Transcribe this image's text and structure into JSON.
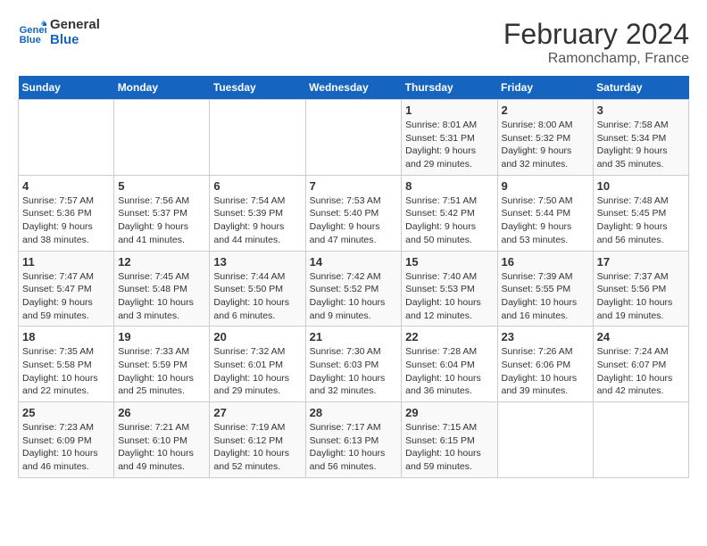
{
  "header": {
    "logo_line1": "General",
    "logo_line2": "Blue",
    "title": "February 2024",
    "subtitle": "Ramonchamp, France"
  },
  "days_of_week": [
    "Sunday",
    "Monday",
    "Tuesday",
    "Wednesday",
    "Thursday",
    "Friday",
    "Saturday"
  ],
  "weeks": [
    {
      "days": [
        {
          "number": "",
          "empty": true
        },
        {
          "number": "",
          "empty": true
        },
        {
          "number": "",
          "empty": true
        },
        {
          "number": "",
          "empty": true
        },
        {
          "number": "1",
          "sunrise": "8:01 AM",
          "sunset": "5:31 PM",
          "daylight": "9 hours and 29 minutes."
        },
        {
          "number": "2",
          "sunrise": "8:00 AM",
          "sunset": "5:32 PM",
          "daylight": "9 hours and 32 minutes."
        },
        {
          "number": "3",
          "sunrise": "7:58 AM",
          "sunset": "5:34 PM",
          "daylight": "9 hours and 35 minutes."
        }
      ]
    },
    {
      "days": [
        {
          "number": "4",
          "sunrise": "7:57 AM",
          "sunset": "5:36 PM",
          "daylight": "9 hours and 38 minutes."
        },
        {
          "number": "5",
          "sunrise": "7:56 AM",
          "sunset": "5:37 PM",
          "daylight": "9 hours and 41 minutes."
        },
        {
          "number": "6",
          "sunrise": "7:54 AM",
          "sunset": "5:39 PM",
          "daylight": "9 hours and 44 minutes."
        },
        {
          "number": "7",
          "sunrise": "7:53 AM",
          "sunset": "5:40 PM",
          "daylight": "9 hours and 47 minutes."
        },
        {
          "number": "8",
          "sunrise": "7:51 AM",
          "sunset": "5:42 PM",
          "daylight": "9 hours and 50 minutes."
        },
        {
          "number": "9",
          "sunrise": "7:50 AM",
          "sunset": "5:44 PM",
          "daylight": "9 hours and 53 minutes."
        },
        {
          "number": "10",
          "sunrise": "7:48 AM",
          "sunset": "5:45 PM",
          "daylight": "9 hours and 56 minutes."
        }
      ]
    },
    {
      "days": [
        {
          "number": "11",
          "sunrise": "7:47 AM",
          "sunset": "5:47 PM",
          "daylight": "9 hours and 59 minutes."
        },
        {
          "number": "12",
          "sunrise": "7:45 AM",
          "sunset": "5:48 PM",
          "daylight": "10 hours and 3 minutes."
        },
        {
          "number": "13",
          "sunrise": "7:44 AM",
          "sunset": "5:50 PM",
          "daylight": "10 hours and 6 minutes."
        },
        {
          "number": "14",
          "sunrise": "7:42 AM",
          "sunset": "5:52 PM",
          "daylight": "10 hours and 9 minutes."
        },
        {
          "number": "15",
          "sunrise": "7:40 AM",
          "sunset": "5:53 PM",
          "daylight": "10 hours and 12 minutes."
        },
        {
          "number": "16",
          "sunrise": "7:39 AM",
          "sunset": "5:55 PM",
          "daylight": "10 hours and 16 minutes."
        },
        {
          "number": "17",
          "sunrise": "7:37 AM",
          "sunset": "5:56 PM",
          "daylight": "10 hours and 19 minutes."
        }
      ]
    },
    {
      "days": [
        {
          "number": "18",
          "sunrise": "7:35 AM",
          "sunset": "5:58 PM",
          "daylight": "10 hours and 22 minutes."
        },
        {
          "number": "19",
          "sunrise": "7:33 AM",
          "sunset": "5:59 PM",
          "daylight": "10 hours and 25 minutes."
        },
        {
          "number": "20",
          "sunrise": "7:32 AM",
          "sunset": "6:01 PM",
          "daylight": "10 hours and 29 minutes."
        },
        {
          "number": "21",
          "sunrise": "7:30 AM",
          "sunset": "6:03 PM",
          "daylight": "10 hours and 32 minutes."
        },
        {
          "number": "22",
          "sunrise": "7:28 AM",
          "sunset": "6:04 PM",
          "daylight": "10 hours and 36 minutes."
        },
        {
          "number": "23",
          "sunrise": "7:26 AM",
          "sunset": "6:06 PM",
          "daylight": "10 hours and 39 minutes."
        },
        {
          "number": "24",
          "sunrise": "7:24 AM",
          "sunset": "6:07 PM",
          "daylight": "10 hours and 42 minutes."
        }
      ]
    },
    {
      "days": [
        {
          "number": "25",
          "sunrise": "7:23 AM",
          "sunset": "6:09 PM",
          "daylight": "10 hours and 46 minutes."
        },
        {
          "number": "26",
          "sunrise": "7:21 AM",
          "sunset": "6:10 PM",
          "daylight": "10 hours and 49 minutes."
        },
        {
          "number": "27",
          "sunrise": "7:19 AM",
          "sunset": "6:12 PM",
          "daylight": "10 hours and 52 minutes."
        },
        {
          "number": "28",
          "sunrise": "7:17 AM",
          "sunset": "6:13 PM",
          "daylight": "10 hours and 56 minutes."
        },
        {
          "number": "29",
          "sunrise": "7:15 AM",
          "sunset": "6:15 PM",
          "daylight": "10 hours and 59 minutes."
        },
        {
          "number": "",
          "empty": true
        },
        {
          "number": "",
          "empty": true
        }
      ]
    }
  ],
  "labels": {
    "sunrise_prefix": "Sunrise: ",
    "sunset_prefix": "Sunset: ",
    "daylight_prefix": "Daylight: "
  }
}
